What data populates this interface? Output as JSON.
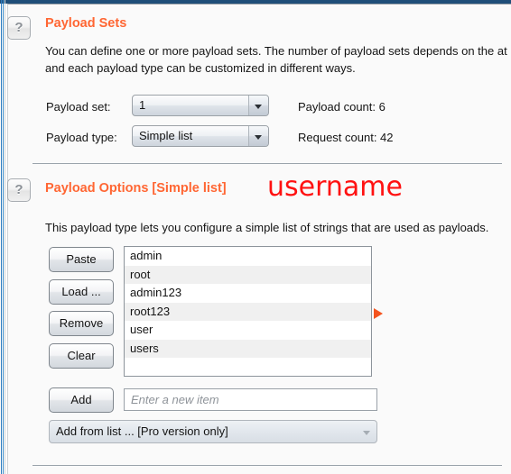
{
  "window": {
    "accent_orange": "#ff6633",
    "annotation_red": "#ff1111",
    "top_bar_blue": "#1f4e79"
  },
  "payload_sets": {
    "help_icon": "?",
    "title": "Payload Sets",
    "description_line1": "You can define one or more payload sets. The number of payload sets depends on the at",
    "description_line2": "and each payload type can be customized in different ways.",
    "payload_set_label": "Payload set:",
    "payload_set_value": "1",
    "payload_type_label": "Payload type:",
    "payload_type_value": "Simple list",
    "payload_count_label": "Payload count:  6",
    "request_count_label": "Request count: 42"
  },
  "payload_options": {
    "help_icon": "?",
    "title": "Payload Options [Simple list]",
    "annotation": "username",
    "description": "This payload type lets you configure a simple list of strings that are used as payloads.",
    "buttons": {
      "paste": "Paste",
      "load": "Load ...",
      "remove": "Remove",
      "clear": "Clear",
      "add": "Add"
    },
    "list_items": [
      "admin",
      "root",
      "admin123",
      "root123",
      "user",
      "users"
    ],
    "new_item_placeholder": "Enter a new item",
    "new_item_value": "",
    "add_from_list_label": "Add from list ... [Pro version only]"
  }
}
